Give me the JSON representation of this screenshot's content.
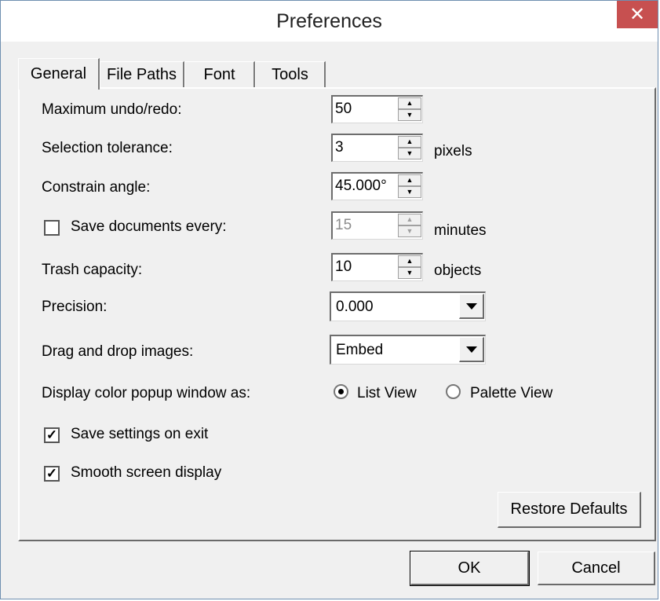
{
  "window": {
    "title": "Preferences",
    "close_glyph": "✕"
  },
  "tabs": [
    {
      "label": "General"
    },
    {
      "label": "File Paths"
    },
    {
      "label": "Font"
    },
    {
      "label": "Tools"
    }
  ],
  "general": {
    "undo": {
      "label": "Maximum undo/redo:",
      "value": "50"
    },
    "tolerance": {
      "label": "Selection tolerance:",
      "value": "3",
      "unit": "pixels"
    },
    "angle": {
      "label": "Constrain angle:",
      "value": "45.000°"
    },
    "autosave": {
      "label": "Save documents every:",
      "value": "15",
      "unit": "minutes",
      "checked": false
    },
    "trash": {
      "label": "Trash capacity:",
      "value": "10",
      "unit": "objects"
    },
    "precision": {
      "label": "Precision:",
      "value": "0.000"
    },
    "dragdrop": {
      "label": "Drag and drop images:",
      "value": "Embed"
    },
    "popup": {
      "label": "Display color popup window as:",
      "option1": "List View",
      "option2": "Palette View",
      "selected": "List View"
    },
    "save_settings": {
      "label": "Save settings on exit",
      "checked": true
    },
    "smooth": {
      "label": "Smooth screen display",
      "checked": true
    },
    "restore_label": "Restore Defaults"
  },
  "footer": {
    "ok_label": "OK",
    "cancel_label": "Cancel"
  }
}
